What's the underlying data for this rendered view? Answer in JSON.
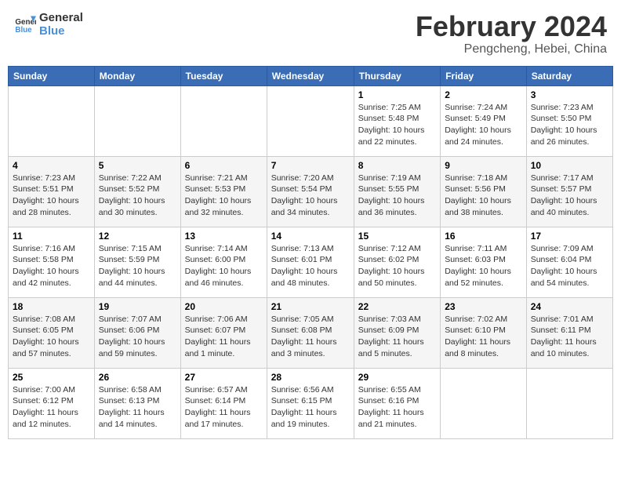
{
  "logo": {
    "line1": "General",
    "line2": "Blue"
  },
  "title": "February 2024",
  "subtitle": "Pengcheng, Hebei, China",
  "days_of_week": [
    "Sunday",
    "Monday",
    "Tuesday",
    "Wednesday",
    "Thursday",
    "Friday",
    "Saturday"
  ],
  "weeks": [
    [
      {
        "day": "",
        "info": ""
      },
      {
        "day": "",
        "info": ""
      },
      {
        "day": "",
        "info": ""
      },
      {
        "day": "",
        "info": ""
      },
      {
        "day": "1",
        "info": "Sunrise: 7:25 AM\nSunset: 5:48 PM\nDaylight: 10 hours\nand 22 minutes."
      },
      {
        "day": "2",
        "info": "Sunrise: 7:24 AM\nSunset: 5:49 PM\nDaylight: 10 hours\nand 24 minutes."
      },
      {
        "day": "3",
        "info": "Sunrise: 7:23 AM\nSunset: 5:50 PM\nDaylight: 10 hours\nand 26 minutes."
      }
    ],
    [
      {
        "day": "4",
        "info": "Sunrise: 7:23 AM\nSunset: 5:51 PM\nDaylight: 10 hours\nand 28 minutes."
      },
      {
        "day": "5",
        "info": "Sunrise: 7:22 AM\nSunset: 5:52 PM\nDaylight: 10 hours\nand 30 minutes."
      },
      {
        "day": "6",
        "info": "Sunrise: 7:21 AM\nSunset: 5:53 PM\nDaylight: 10 hours\nand 32 minutes."
      },
      {
        "day": "7",
        "info": "Sunrise: 7:20 AM\nSunset: 5:54 PM\nDaylight: 10 hours\nand 34 minutes."
      },
      {
        "day": "8",
        "info": "Sunrise: 7:19 AM\nSunset: 5:55 PM\nDaylight: 10 hours\nand 36 minutes."
      },
      {
        "day": "9",
        "info": "Sunrise: 7:18 AM\nSunset: 5:56 PM\nDaylight: 10 hours\nand 38 minutes."
      },
      {
        "day": "10",
        "info": "Sunrise: 7:17 AM\nSunset: 5:57 PM\nDaylight: 10 hours\nand 40 minutes."
      }
    ],
    [
      {
        "day": "11",
        "info": "Sunrise: 7:16 AM\nSunset: 5:58 PM\nDaylight: 10 hours\nand 42 minutes."
      },
      {
        "day": "12",
        "info": "Sunrise: 7:15 AM\nSunset: 5:59 PM\nDaylight: 10 hours\nand 44 minutes."
      },
      {
        "day": "13",
        "info": "Sunrise: 7:14 AM\nSunset: 6:00 PM\nDaylight: 10 hours\nand 46 minutes."
      },
      {
        "day": "14",
        "info": "Sunrise: 7:13 AM\nSunset: 6:01 PM\nDaylight: 10 hours\nand 48 minutes."
      },
      {
        "day": "15",
        "info": "Sunrise: 7:12 AM\nSunset: 6:02 PM\nDaylight: 10 hours\nand 50 minutes."
      },
      {
        "day": "16",
        "info": "Sunrise: 7:11 AM\nSunset: 6:03 PM\nDaylight: 10 hours\nand 52 minutes."
      },
      {
        "day": "17",
        "info": "Sunrise: 7:09 AM\nSunset: 6:04 PM\nDaylight: 10 hours\nand 54 minutes."
      }
    ],
    [
      {
        "day": "18",
        "info": "Sunrise: 7:08 AM\nSunset: 6:05 PM\nDaylight: 10 hours\nand 57 minutes."
      },
      {
        "day": "19",
        "info": "Sunrise: 7:07 AM\nSunset: 6:06 PM\nDaylight: 10 hours\nand 59 minutes."
      },
      {
        "day": "20",
        "info": "Sunrise: 7:06 AM\nSunset: 6:07 PM\nDaylight: 11 hours\nand 1 minute."
      },
      {
        "day": "21",
        "info": "Sunrise: 7:05 AM\nSunset: 6:08 PM\nDaylight: 11 hours\nand 3 minutes."
      },
      {
        "day": "22",
        "info": "Sunrise: 7:03 AM\nSunset: 6:09 PM\nDaylight: 11 hours\nand 5 minutes."
      },
      {
        "day": "23",
        "info": "Sunrise: 7:02 AM\nSunset: 6:10 PM\nDaylight: 11 hours\nand 8 minutes."
      },
      {
        "day": "24",
        "info": "Sunrise: 7:01 AM\nSunset: 6:11 PM\nDaylight: 11 hours\nand 10 minutes."
      }
    ],
    [
      {
        "day": "25",
        "info": "Sunrise: 7:00 AM\nSunset: 6:12 PM\nDaylight: 11 hours\nand 12 minutes."
      },
      {
        "day": "26",
        "info": "Sunrise: 6:58 AM\nSunset: 6:13 PM\nDaylight: 11 hours\nand 14 minutes."
      },
      {
        "day": "27",
        "info": "Sunrise: 6:57 AM\nSunset: 6:14 PM\nDaylight: 11 hours\nand 17 minutes."
      },
      {
        "day": "28",
        "info": "Sunrise: 6:56 AM\nSunset: 6:15 PM\nDaylight: 11 hours\nand 19 minutes."
      },
      {
        "day": "29",
        "info": "Sunrise: 6:55 AM\nSunset: 6:16 PM\nDaylight: 11 hours\nand 21 minutes."
      },
      {
        "day": "",
        "info": ""
      },
      {
        "day": "",
        "info": ""
      }
    ]
  ]
}
